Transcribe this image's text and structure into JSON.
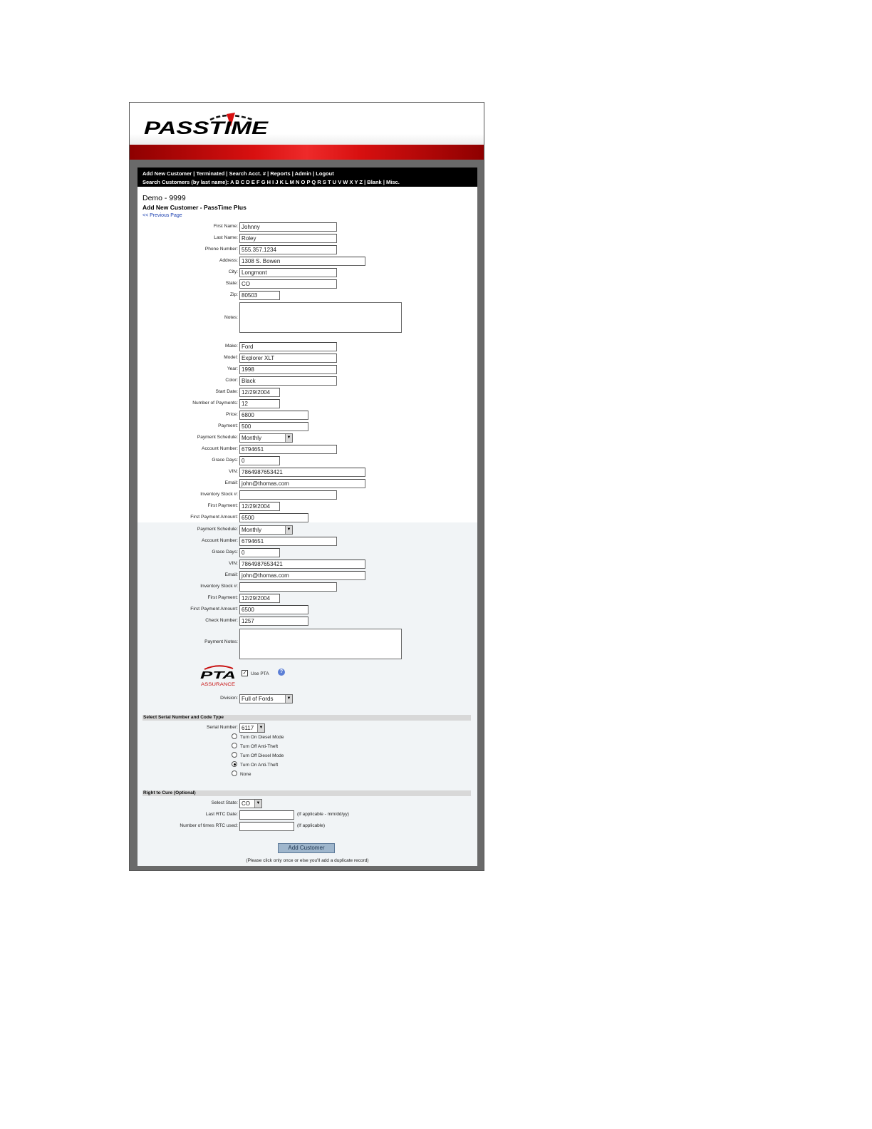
{
  "brand": {
    "logo_text": "PASSTIME"
  },
  "nav": {
    "row1": [
      "Add New Customer",
      "Terminated",
      "Search Acct. #",
      "Reports",
      "Admin",
      "Logout"
    ],
    "row2_label": "Search Customers (by last name):",
    "letters": [
      "A",
      "B",
      "C",
      "D",
      "E",
      "F",
      "G",
      "H",
      "I",
      "J",
      "K",
      "L",
      "M",
      "N",
      "O",
      "P",
      "Q",
      "R",
      "S",
      "T",
      "U",
      "V",
      "W",
      "X",
      "Y",
      "Z"
    ],
    "extra": [
      "Blank",
      "Misc."
    ]
  },
  "header": {
    "account_title": "Demo - 9999",
    "page_subtitle": "Add New Customer - PassTime Plus",
    "prev_link": "<< Previous Page"
  },
  "customer": {
    "first_name": {
      "label": "First Name:",
      "value": "Johnny"
    },
    "last_name": {
      "label": "Last Name:",
      "value": "Roley"
    },
    "phone": {
      "label": "Phone Number:",
      "value": "555.357.1234"
    },
    "address": {
      "label": "Address:",
      "value": "1308 S. Bowen"
    },
    "city": {
      "label": "City:",
      "value": "Longmont"
    },
    "state": {
      "label": "State:",
      "value": "CO"
    },
    "zip": {
      "label": "Zip:",
      "value": "80503"
    },
    "notes": {
      "label": "Notes:",
      "value": ""
    }
  },
  "vehicle": {
    "make": {
      "label": "Make:",
      "value": "Ford"
    },
    "model": {
      "label": "Model:",
      "value": "Explorer XLT"
    },
    "year": {
      "label": "Year:",
      "value": "1998"
    },
    "color": {
      "label": "Color:",
      "value": "Black"
    },
    "start_date": {
      "label": "Start Date:",
      "value": "12/29/2004"
    },
    "num_payments": {
      "label": "Number of Payments:",
      "value": "12"
    },
    "price": {
      "label": "Price:",
      "value": "6800"
    },
    "payment": {
      "label": "Payment:",
      "value": "500"
    }
  },
  "payment_block_1": {
    "schedule": {
      "label": "Payment Schedule:",
      "value": "Monthly"
    },
    "account_number": {
      "label": "Account Number:",
      "value": "6794651"
    },
    "grace_days": {
      "label": "Grace Days:",
      "value": "0"
    },
    "vin": {
      "label": "VIN:",
      "value": "7864987653421"
    },
    "email": {
      "label": "Email:",
      "value": "john@thomas.com"
    },
    "inventory": {
      "label": "Inventory Stock #:",
      "value": ""
    },
    "first_payment": {
      "label": "First Payment:",
      "value": "12/29/2004"
    },
    "first_payment_amount": {
      "label": "First Payment Amount:",
      "value": "6500"
    }
  },
  "payment_block_2": {
    "schedule": {
      "label": "Payment Schedule:",
      "value": "Monthly"
    },
    "account_number": {
      "label": "Account Number:",
      "value": "6794651"
    },
    "grace_days": {
      "label": "Grace Days:",
      "value": "0"
    },
    "vin": {
      "label": "VIN:",
      "value": "7864987653421"
    },
    "email": {
      "label": "Email:",
      "value": "john@thomas.com"
    },
    "inventory": {
      "label": "Inventory Stock #:",
      "value": ""
    },
    "first_payment": {
      "label": "First Payment:",
      "value": "12/29/2004"
    },
    "first_payment_amount": {
      "label": "First Payment Amount:",
      "value": "6500"
    },
    "check_number": {
      "label": "Check Number:",
      "value": "1257"
    },
    "payment_notes": {
      "label": "Payment Notes:",
      "value": ""
    }
  },
  "pta": {
    "logo_text": "PTA",
    "logo_subtext": "ASSURANCE",
    "use_label": "Use PTA",
    "checked": true,
    "help_glyph": "?",
    "division_label": "Division:",
    "division_value": "Full of Fords"
  },
  "serial_section": {
    "title": "Select Serial Number and Code Type",
    "serial_label": "Serial Number:",
    "serial_value": "6117",
    "options": [
      {
        "label": "Turn On Diesel Mode",
        "checked": false
      },
      {
        "label": "Turn Off Anti-Theft",
        "checked": false
      },
      {
        "label": "Turn Off Diesel Mode",
        "checked": false
      },
      {
        "label": "Turn On Anti-Theft",
        "checked": true
      },
      {
        "label": "None",
        "checked": false
      }
    ]
  },
  "rtc_section": {
    "title": "Right to Cure (Optional)",
    "state_label": "Select State:",
    "state_value": "CO",
    "last_date_label": "Last RTC Date:",
    "last_date_value": "",
    "last_date_hint": "(If applicable - mm/dd/yy)",
    "times_label": "Number of times RTC used:",
    "times_value": "",
    "times_hint": "(If applicable)"
  },
  "submit": {
    "label": "Add Customer",
    "note": "(Please click only once or else you'll add a duplicate record)"
  },
  "colors": {
    "accent_red": "#d81010",
    "nav_bg": "#000000",
    "link_blue": "#1a3fb0",
    "button_bg": "#9fb6cc"
  }
}
